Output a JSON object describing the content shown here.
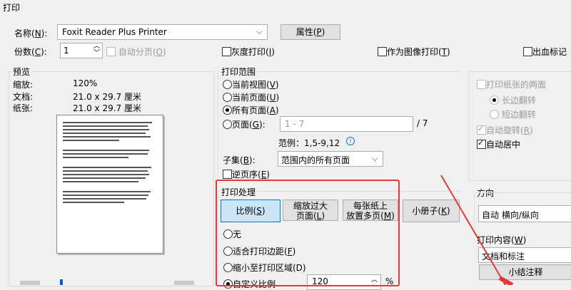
{
  "window": {
    "title": "打印"
  },
  "printer": {
    "name_label": "名称(",
    "name_key": "N",
    "name_end": "):",
    "selected": "Foxit Reader Plus Printer",
    "properties_btn": "属性(",
    "properties_key": "P",
    "properties_end": ")"
  },
  "copies": {
    "label": "份数(",
    "key": "C",
    "end": "):",
    "value": "1",
    "collate": "自动分页(",
    "collate_key": "O",
    "collate_end": ")"
  },
  "options": {
    "grayscale": "灰度打印(",
    "grayscale_key": "I",
    "grayscale_end": ")",
    "as_image": "作为图像打印(",
    "as_image_key": "T",
    "as_image_end": ")",
    "bleed": "出血标记"
  },
  "preview": {
    "title": "预览",
    "zoom_label": "缩放:",
    "zoom_value": "120%",
    "doc_label": "文档:",
    "doc_value": "21.0 x 29.7 厘米",
    "paper_label": "纸张:",
    "paper_value": "21.0 x 29.7 厘米"
  },
  "range": {
    "title": "打印范围",
    "current_view": "当前视图(",
    "current_view_key": "V",
    "current_view_end": ")",
    "current_page": "当前页面(",
    "current_page_key": "U",
    "current_page_end": ")",
    "all_pages": "所有页面(",
    "all_pages_key": "A",
    "all_pages_end": ")",
    "pages": "页面(",
    "pages_key": "G",
    "pages_end": "):",
    "pages_value": "1 - 7",
    "pages_total": "/ 7",
    "example": "范例：1,5-9,12",
    "subset_label": "子集(",
    "subset_key": "B",
    "subset_end": "):",
    "subset_value": "范围内的所有页面",
    "reverse": "逆页序(",
    "reverse_key": "E",
    "reverse_end": ")"
  },
  "handling": {
    "title": "打印处理",
    "tab_scale": "比例(",
    "tab_scale_key": "S",
    "tab_scale_end": ")",
    "tab_fit_1": "缩放过大",
    "tab_fit_2": "页面(",
    "tab_fit_key": "L",
    "tab_fit_end": ")",
    "tab_multi_1": "每张纸上",
    "tab_multi_2": "放置多页(",
    "tab_multi_key": "M",
    "tab_multi_end": ")",
    "tab_booklet": "小册子(",
    "tab_booklet_key": "K",
    "tab_booklet_end": ")",
    "opt_none": "无",
    "opt_fit_margins": "适合打印边距(",
    "opt_fit_margins_key": "F",
    "opt_fit_margins_end": ")",
    "opt_shrink": "缩小至打印区域(D)",
    "opt_custom": "自定义比例",
    "custom_value": "120",
    "custom_unit": "%"
  },
  "duplex": {
    "both_sides": "打印纸张的两面",
    "long_edge": "长边翻转",
    "short_edge": "短边翻转",
    "auto_rotate": "自动旋转(",
    "auto_rotate_key": "R",
    "auto_rotate_end": ")",
    "auto_center": "自动居中"
  },
  "orientation": {
    "title": "方向",
    "value": "自动 横向/纵向"
  },
  "content": {
    "title": "打印内容(",
    "title_key": "W",
    "title_end": ")",
    "value": "文档和标注",
    "summarize_btn": "小结注释"
  },
  "colors": {
    "annotation_red": "#e03a3a",
    "accent_blue": "#0078d7"
  }
}
